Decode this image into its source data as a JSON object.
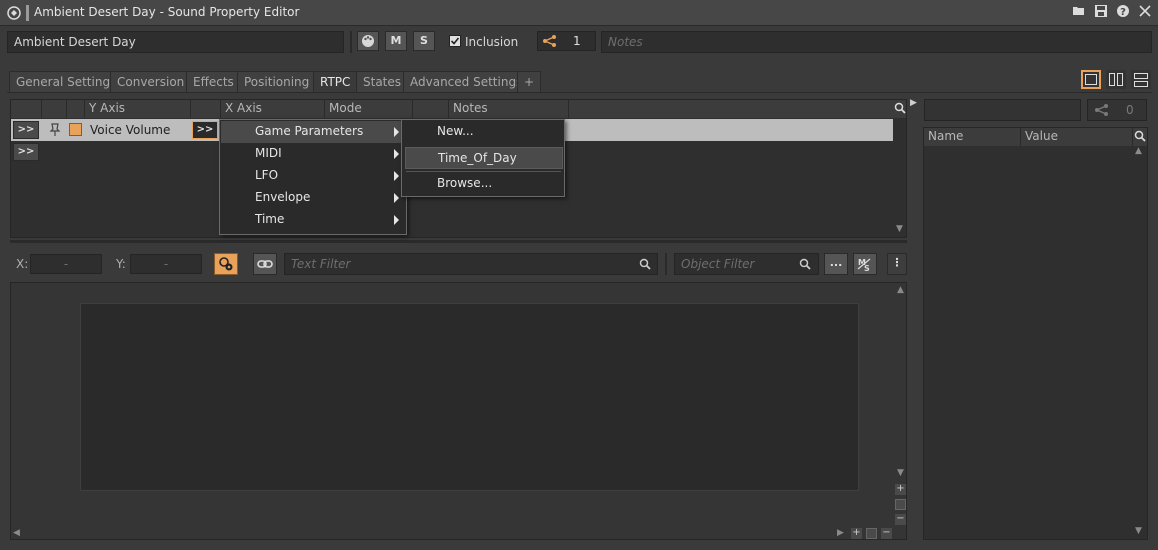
{
  "window": {
    "title": "Ambient Desert Day - Sound Property Editor"
  },
  "header": {
    "object_name": "Ambient Desert Day",
    "m_label": "M",
    "s_label": "S",
    "inclusion_label": "Inclusion",
    "inclusion_checked": true,
    "share_count": "1",
    "notes_placeholder": "Notes"
  },
  "tabs": [
    {
      "label": "General Settings"
    },
    {
      "label": "Conversion"
    },
    {
      "label": "Effects"
    },
    {
      "label": "Positioning"
    },
    {
      "label": "RTPC"
    },
    {
      "label": "States"
    },
    {
      "label": "Advanced Settings"
    },
    {
      "label": "+"
    }
  ],
  "rtpc_table": {
    "columns": {
      "y_axis": "Y Axis",
      "x_axis": "X Axis",
      "mode": "Mode",
      "notes": "Notes"
    },
    "row": {
      "expand": ">>",
      "y_axis": "Voice Volume",
      "x_button": ">>"
    },
    "add_button": ">>"
  },
  "context_menu": {
    "items": [
      {
        "label": "Game Parameters"
      },
      {
        "label": "MIDI"
      },
      {
        "label": "LFO"
      },
      {
        "label": "Envelope"
      },
      {
        "label": "Time"
      }
    ],
    "submenu": [
      {
        "label": "New..."
      },
      {
        "label": "Time_Of_Day"
      },
      {
        "label": "Browse..."
      }
    ]
  },
  "graph_toolbar": {
    "x_label": "X:",
    "x_value": "-",
    "y_label": "Y:",
    "y_value": "-",
    "text_filter_placeholder": "Text Filter",
    "object_filter_placeholder": "Object Filter",
    "more_label": "..."
  },
  "right_panel": {
    "share_count": "0",
    "columns": {
      "name": "Name",
      "value": "Value"
    }
  },
  "colors": {
    "accent_orange": "#e8a25a",
    "selected_row": "#bdbdbd",
    "menu_bg": "#2a2a2a"
  }
}
